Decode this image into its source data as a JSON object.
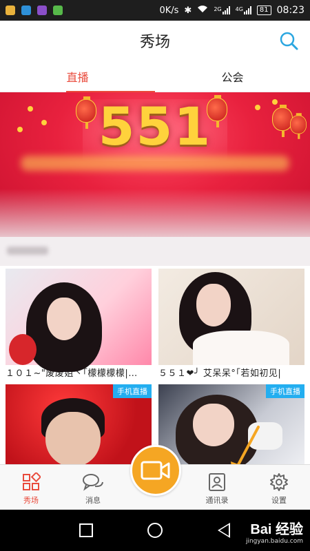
{
  "status_bar": {
    "speed": "0K/s",
    "network_1": "2G",
    "network_2": "4G",
    "battery": "81",
    "time": "08:23"
  },
  "header": {
    "title": "秀场",
    "search_icon": "search-icon"
  },
  "tabs": [
    {
      "label": "直播",
      "active": true
    },
    {
      "label": "公会",
      "active": false
    }
  ],
  "banner": {
    "headline": "551"
  },
  "cards": [
    {
      "name": "１０１~\"废废姐丶｢檬檬檬檬|…",
      "badge": ""
    },
    {
      "name": "５５１❤╯ 艾呆呆°｢若如初见|",
      "badge": ""
    },
    {
      "name": "",
      "badge": "手机直播"
    },
    {
      "name": "",
      "badge": "手机直播"
    }
  ],
  "bottom_nav": [
    {
      "label": "秀场",
      "icon": "grid-diamond-icon",
      "active": true
    },
    {
      "label": "消息",
      "icon": "chat-bubbles-icon",
      "active": false
    },
    {
      "label": "",
      "icon": "video-camera-icon",
      "active": false
    },
    {
      "label": "通讯录",
      "icon": "contact-card-icon",
      "active": false
    },
    {
      "label": "设置",
      "icon": "gear-icon",
      "active": false
    }
  ],
  "watermark": {
    "logo": "Bai 经验",
    "url": "jingyan.baidu.com"
  },
  "colors": {
    "accent": "#e94b3c",
    "camera": "#f5a623",
    "live_badge": "#23aef0"
  }
}
